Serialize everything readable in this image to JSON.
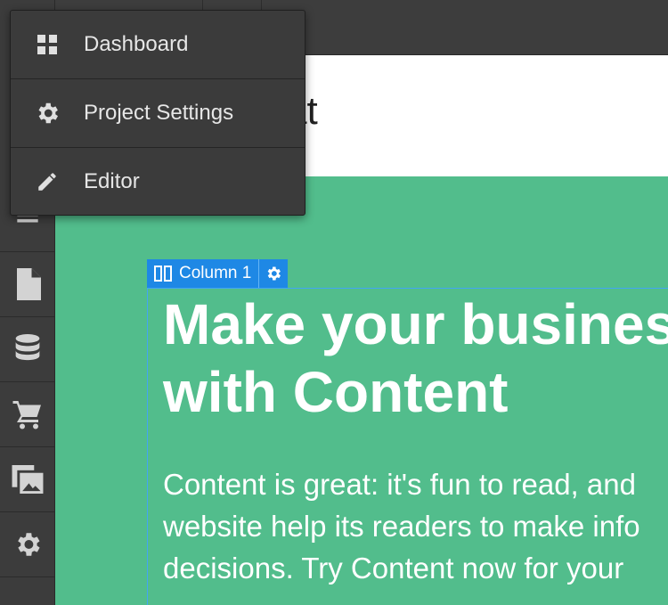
{
  "menu": {
    "items": [
      {
        "label": "Dashboard",
        "icon": "grid-icon"
      },
      {
        "label": "Project Settings",
        "icon": "gear-icon"
      },
      {
        "label": "Editor",
        "icon": "pencil-icon"
      }
    ]
  },
  "sidebar": {
    "items": [
      {
        "icon": "layers-icon"
      },
      {
        "icon": "page-icon"
      },
      {
        "icon": "database-icon"
      },
      {
        "icon": "cart-icon"
      },
      {
        "icon": "media-icon"
      },
      {
        "icon": "settings-icon"
      }
    ]
  },
  "canvas": {
    "site_title_fragment": "at",
    "column_tag": "Column 1",
    "hero_heading_line1": "Make your busines",
    "hero_heading_line2": "with Content",
    "hero_text_line1": "Content is great: it's fun to read, and",
    "hero_text_line2": "website help its readers to make info",
    "hero_text_line3": "decisions. Try Content now for your"
  },
  "colors": {
    "hero_bg": "#52bd8c",
    "selection_blue": "#1e88e5",
    "menu_bg": "#3b3b3b"
  }
}
